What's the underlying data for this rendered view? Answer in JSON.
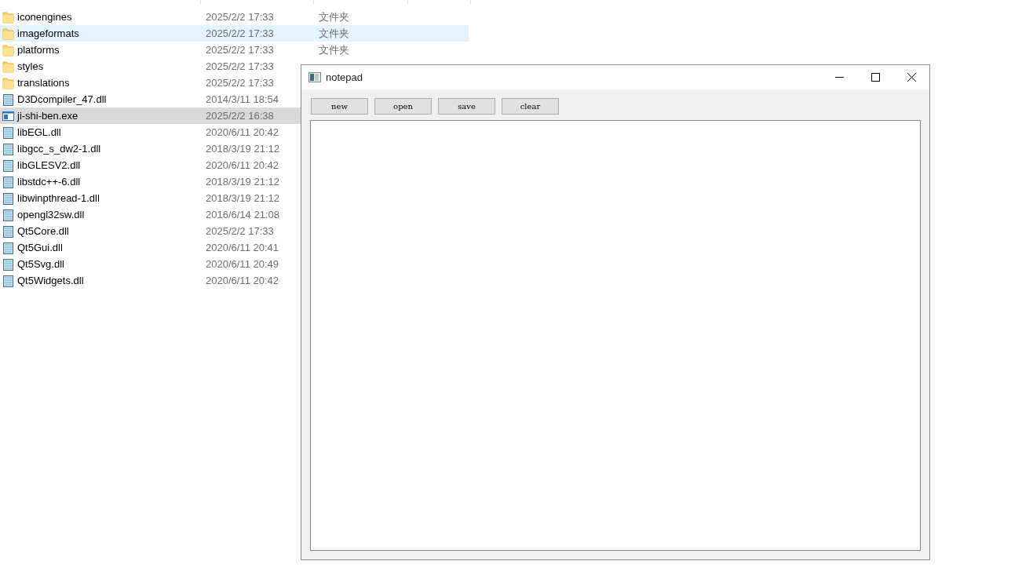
{
  "files": [
    {
      "name": "iconengines",
      "kind": "folder",
      "date": "2025/2/2 17:33",
      "type": "文件夹",
      "hovered": false,
      "selected": false
    },
    {
      "name": "imageformats",
      "kind": "folder",
      "date": "2025/2/2 17:33",
      "type": "文件夹",
      "hovered": true,
      "selected": false
    },
    {
      "name": "platforms",
      "kind": "folder",
      "date": "2025/2/2 17:33",
      "type": "文件夹",
      "hovered": false,
      "selected": false
    },
    {
      "name": "styles",
      "kind": "folder",
      "date": "2025/2/2 17:33",
      "hovered": false,
      "selected": false
    },
    {
      "name": "translations",
      "kind": "folder",
      "date": "2025/2/2 17:33",
      "hovered": false,
      "selected": false
    },
    {
      "name": "D3Dcompiler_47.dll",
      "kind": "dll",
      "date": "2014/3/11 18:54",
      "hovered": false,
      "selected": false
    },
    {
      "name": "ji-shi-ben.exe",
      "kind": "exe",
      "date": "2025/2/2 16:38",
      "hovered": false,
      "selected": true
    },
    {
      "name": "libEGL.dll",
      "kind": "dll",
      "date": "2020/6/11 20:42",
      "hovered": false,
      "selected": false
    },
    {
      "name": "libgcc_s_dw2-1.dll",
      "kind": "dll",
      "date": "2018/3/19 21:12",
      "hovered": false,
      "selected": false
    },
    {
      "name": "libGLESV2.dll",
      "kind": "dll",
      "date": "2020/6/11 20:42",
      "hovered": false,
      "selected": false
    },
    {
      "name": "libstdc++-6.dll",
      "kind": "dll",
      "date": "2018/3/19 21:12",
      "hovered": false,
      "selected": false
    },
    {
      "name": "libwinpthread-1.dll",
      "kind": "dll",
      "date": "2018/3/19 21:12",
      "hovered": false,
      "selected": false
    },
    {
      "name": "opengl32sw.dll",
      "kind": "dll",
      "date": "2016/6/14 21:08",
      "hovered": false,
      "selected": false
    },
    {
      "name": "Qt5Core.dll",
      "kind": "dll",
      "date": "2025/2/2 17:33",
      "hovered": false,
      "selected": false
    },
    {
      "name": "Qt5Gui.dll",
      "kind": "dll",
      "date": "2020/6/11 20:41",
      "hovered": false,
      "selected": false
    },
    {
      "name": "Qt5Svg.dll",
      "kind": "dll",
      "date": "2020/6/11 20:49",
      "hovered": false,
      "selected": false
    },
    {
      "name": "Qt5Widgets.dll",
      "kind": "dll",
      "date": "2020/6/11 20:42",
      "hovered": false,
      "selected": false
    }
  ],
  "window": {
    "title": "notepad"
  },
  "buttons": [
    "new",
    "open",
    "save",
    "clear"
  ]
}
